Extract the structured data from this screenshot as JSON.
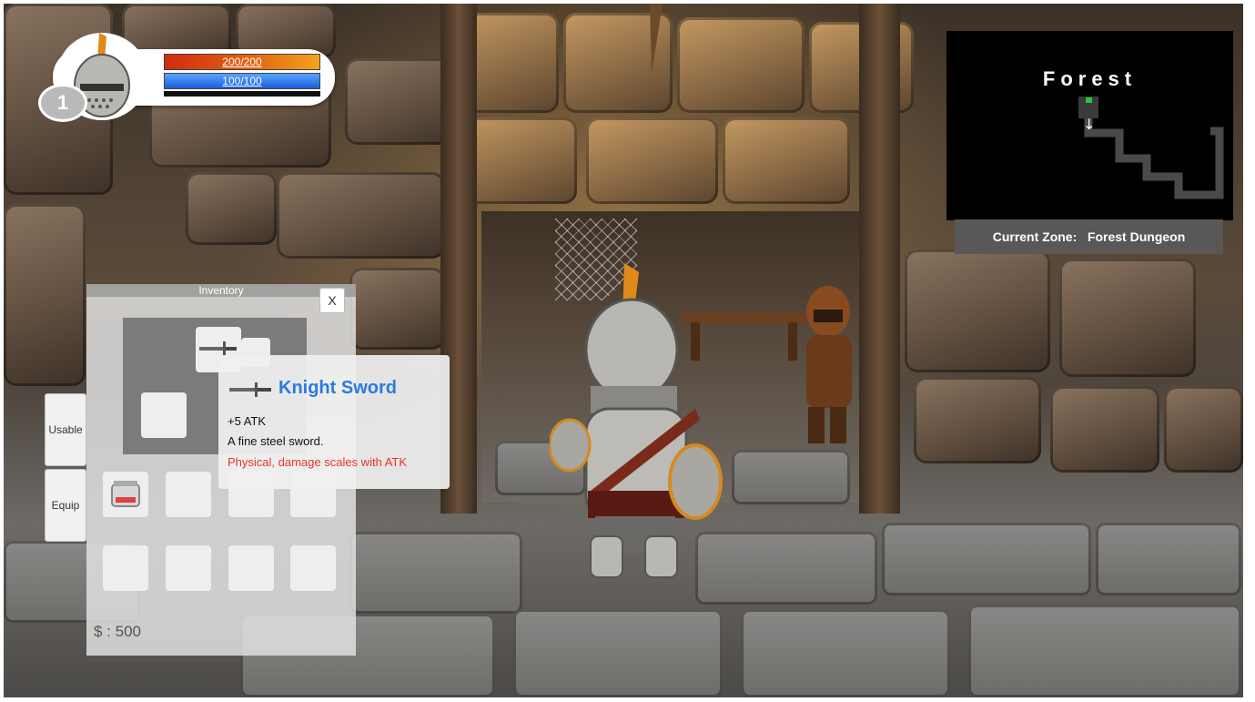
{
  "hud": {
    "level": "1",
    "hp_text": "200/200",
    "mp_text": "100/100"
  },
  "minimap": {
    "title": "Forest",
    "zone_label": "Current Zone:",
    "zone_name": "Forest Dungeon"
  },
  "inventory": {
    "title": "Inventory",
    "close_label": "X",
    "tabs": [
      {
        "label": "Usable"
      },
      {
        "label": "Equip"
      }
    ],
    "money_label": "$ :",
    "money_value": "500"
  },
  "tooltip": {
    "item_name": "Knight Sword",
    "stat": "+5 ATK",
    "description": "A fine steel sword.",
    "note": "Physical, damage scales with ATK"
  },
  "colors": {
    "item_name": "#2a7be0",
    "note_red": "#e8322d",
    "hp": "#d12b10",
    "mp": "#1a5fd8",
    "minimap_player": "#22c93a"
  },
  "icons": {
    "sword": "sword-icon",
    "potion": "jar-icon"
  }
}
